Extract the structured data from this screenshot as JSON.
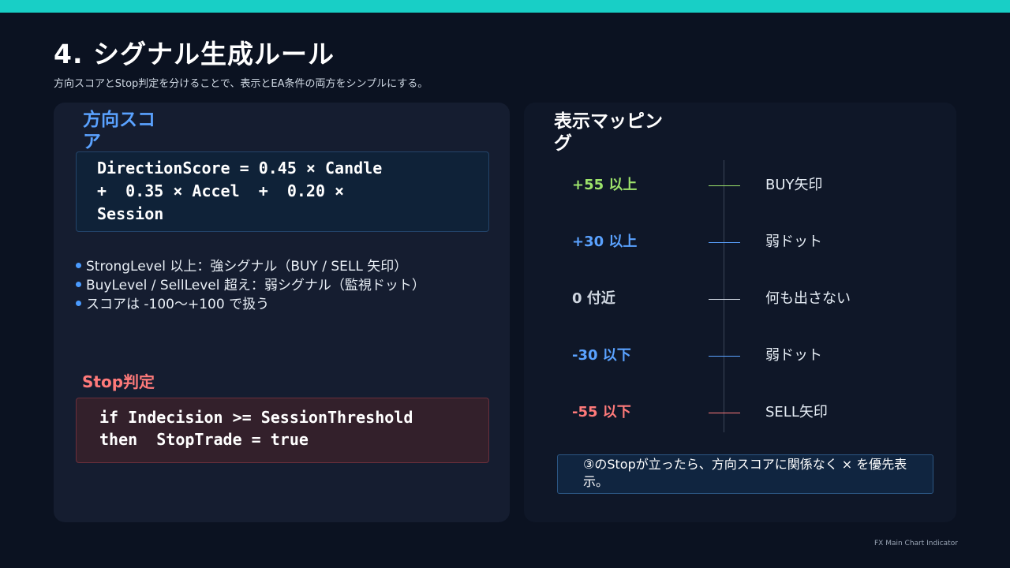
{
  "slide": {
    "title": "4. シグナル生成ルール",
    "subtitle": "方向スコアとStop判定を分けることで、表示とEA条件の両方をシンプルにする。",
    "footer": "FX Main Chart Indicator",
    "accent_color": "#18cfc6"
  },
  "direction": {
    "heading": "方向スコア",
    "formula": "DirectionScore = 0.45 × Candle\n+  0.35 × Accel  +  0.20 ×\nSession",
    "bullets": [
      "StrongLevel 以上：強シグナル（BUY / SELL 矢印）",
      "BuyLevel / SellLevel 超え：弱シグナル（監視ドット）",
      "スコアは -100〜+100 で扱う"
    ]
  },
  "stop": {
    "heading": "Stop判定",
    "code": "if Indecision >= SessionThreshold\nthen  StopTrade = true"
  },
  "mapping": {
    "heading": "表示マッピング",
    "rows": [
      {
        "score": "+55 以上",
        "action": "BUY矢印",
        "color": "#9de36b"
      },
      {
        "score": "+30 以上",
        "action": "弱ドット",
        "color": "#5aa2ff"
      },
      {
        "score": "0 付近",
        "action": "何も出さない",
        "color": "#cfd6e0"
      },
      {
        "score": "-30 以下",
        "action": "弱ドット",
        "color": "#5aa2ff"
      },
      {
        "score": "-55 以下",
        "action": "SELL矢印",
        "color": "#ff7a7a"
      }
    ],
    "note": "③のStopが立ったら、方向スコアに関係なく × を優先表示。"
  }
}
